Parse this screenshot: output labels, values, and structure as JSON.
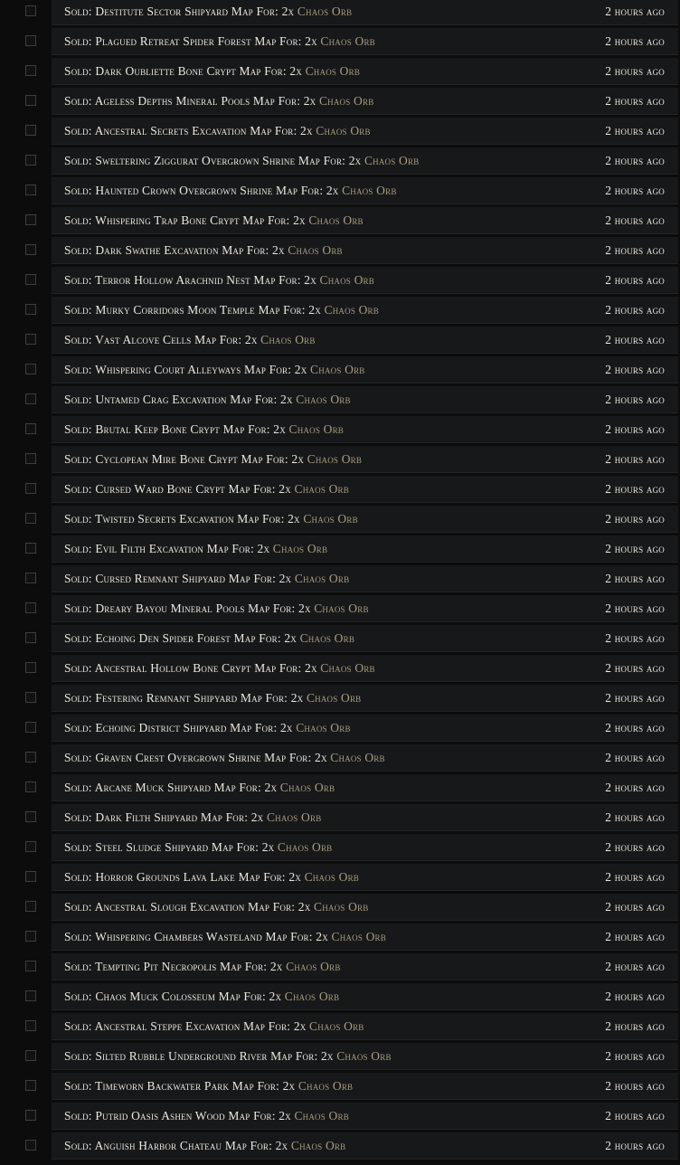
{
  "notifications": [
    {
      "text": "Sold: Destitute Sector Shipyard Map For: 2x",
      "currency": "Chaos Orb",
      "time": "2 hours ago"
    },
    {
      "text": "Sold: Plagued Retreat Spider Forest Map For: 2x",
      "currency": "Chaos Orb",
      "time": "2 hours ago"
    },
    {
      "text": "Sold: Dark Oubliette Bone Crypt Map For: 2x",
      "currency": "Chaos Orb",
      "time": "2 hours ago"
    },
    {
      "text": "Sold: Ageless Depths Mineral Pools Map For: 2x",
      "currency": "Chaos Orb",
      "time": "2 hours ago"
    },
    {
      "text": "Sold: Ancestral Secrets Excavation Map For: 2x",
      "currency": "Chaos Orb",
      "time": "2 hours ago"
    },
    {
      "text": "Sold: Sweltering Ziggurat Overgrown Shrine Map For: 2x",
      "currency": "Chaos Orb",
      "time": "2 hours ago"
    },
    {
      "text": "Sold: Haunted Crown Overgrown Shrine Map For: 2x",
      "currency": "Chaos Orb",
      "time": "2 hours ago"
    },
    {
      "text": "Sold: Whispering Trap Bone Crypt Map For: 2x",
      "currency": "Chaos Orb",
      "time": "2 hours ago"
    },
    {
      "text": "Sold: Dark Swathe Excavation Map For: 2x",
      "currency": "Chaos Orb",
      "time": "2 hours ago"
    },
    {
      "text": "Sold: Terror Hollow Arachnid Nest Map For: 2x",
      "currency": "Chaos Orb",
      "time": "2 hours ago"
    },
    {
      "text": "Sold: Murky Corridors Moon Temple Map For: 2x",
      "currency": "Chaos Orb",
      "time": "2 hours ago"
    },
    {
      "text": "Sold: Vast Alcove Cells Map For: 2x",
      "currency": "Chaos Orb",
      "time": "2 hours ago"
    },
    {
      "text": "Sold: Whispering Court Alleyways Map For: 2x",
      "currency": "Chaos Orb",
      "time": "2 hours ago"
    },
    {
      "text": "Sold: Untamed Crag Excavation Map For: 2x",
      "currency": "Chaos Orb",
      "time": "2 hours ago"
    },
    {
      "text": "Sold: Brutal Keep Bone Crypt Map For: 2x",
      "currency": "Chaos Orb",
      "time": "2 hours ago"
    },
    {
      "text": "Sold: Cyclopean Mire Bone Crypt Map For: 2x",
      "currency": "Chaos Orb",
      "time": "2 hours ago"
    },
    {
      "text": "Sold: Cursed Ward Bone Crypt Map For: 2x",
      "currency": "Chaos Orb",
      "time": "2 hours ago"
    },
    {
      "text": "Sold: Twisted Secrets Excavation Map For: 2x",
      "currency": "Chaos Orb",
      "time": "2 hours ago"
    },
    {
      "text": "Sold: Evil Filth Excavation Map For: 2x",
      "currency": "Chaos Orb",
      "time": "2 hours ago"
    },
    {
      "text": "Sold: Cursed Remnant Shipyard Map For: 2x",
      "currency": "Chaos Orb",
      "time": "2 hours ago"
    },
    {
      "text": "Sold: Dreary Bayou Mineral Pools Map For: 2x",
      "currency": "Chaos Orb",
      "time": "2 hours ago"
    },
    {
      "text": "Sold: Echoing Den Spider Forest Map For: 2x",
      "currency": "Chaos Orb",
      "time": "2 hours ago"
    },
    {
      "text": "Sold: Ancestral Hollow Bone Crypt Map For: 2x",
      "currency": "Chaos Orb",
      "time": "2 hours ago"
    },
    {
      "text": "Sold: Festering Remnant Shipyard Map For: 2x",
      "currency": "Chaos Orb",
      "time": "2 hours ago"
    },
    {
      "text": "Sold: Echoing District Shipyard Map For: 2x",
      "currency": "Chaos Orb",
      "time": "2 hours ago"
    },
    {
      "text": "Sold: Graven Crest Overgrown Shrine Map For: 2x",
      "currency": "Chaos Orb",
      "time": "2 hours ago"
    },
    {
      "text": "Sold: Arcane Muck Shipyard Map For: 2x",
      "currency": "Chaos Orb",
      "time": "2 hours ago"
    },
    {
      "text": "Sold: Dark Filth Shipyard Map For: 2x",
      "currency": "Chaos Orb",
      "time": "2 hours ago"
    },
    {
      "text": "Sold: Steel Sludge Shipyard Map For: 2x",
      "currency": "Chaos Orb",
      "time": "2 hours ago"
    },
    {
      "text": "Sold: Horror Grounds Lava Lake Map For: 2x",
      "currency": "Chaos Orb",
      "time": "2 hours ago"
    },
    {
      "text": "Sold: Ancestral Slough Excavation Map For: 2x",
      "currency": "Chaos Orb",
      "time": "2 hours ago"
    },
    {
      "text": "Sold: Whispering Chambers Wasteland Map For: 2x",
      "currency": "Chaos Orb",
      "time": "2 hours ago"
    },
    {
      "text": "Sold: Tempting Pit Necropolis Map For: 2x",
      "currency": "Chaos Orb",
      "time": "2 hours ago"
    },
    {
      "text": "Sold: Chaos Muck Colosseum Map For: 2x",
      "currency": "Chaos Orb",
      "time": "2 hours ago"
    },
    {
      "text": "Sold: Ancestral Steppe Excavation Map For: 2x",
      "currency": "Chaos Orb",
      "time": "2 hours ago"
    },
    {
      "text": "Sold: Silted Rubble Underground River Map For: 2x",
      "currency": "Chaos Orb",
      "time": "2 hours ago"
    },
    {
      "text": "Sold: Timeworn Backwater Park Map For: 2x",
      "currency": "Chaos Orb",
      "time": "2 hours ago"
    },
    {
      "text": "Sold: Putrid Oasis Ashen Wood Map For: 2x",
      "currency": "Chaos Orb",
      "time": "2 hours ago"
    },
    {
      "text": "Sold: Anguish Harbor Chateau Map For: 2x",
      "currency": "Chaos Orb",
      "time": "2 hours ago"
    }
  ],
  "colors": {
    "background": "#0c0c0c",
    "row_background": "#17181a",
    "text": "#ece8de",
    "currency": "#aa9e82"
  }
}
